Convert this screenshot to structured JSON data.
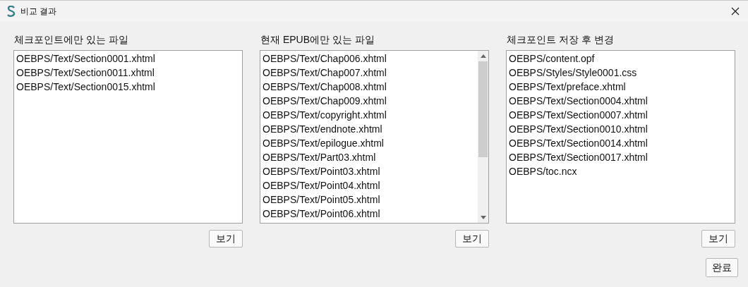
{
  "window": {
    "title": "비교 결과"
  },
  "panels": [
    {
      "label": "체크포인트에만 있는 파일",
      "items": [
        "OEBPS/Text/Section0001.xhtml",
        "OEBPS/Text/Section0011.xhtml",
        "OEBPS/Text/Section0015.xhtml"
      ],
      "scrollable": false,
      "button": "보기"
    },
    {
      "label": "현재 EPUB에만 있는 파일",
      "items": [
        "OEBPS/Text/Chap006.xhtml",
        "OEBPS/Text/Chap007.xhtml",
        "OEBPS/Text/Chap008.xhtml",
        "OEBPS/Text/Chap009.xhtml",
        "OEBPS/Text/copyright.xhtml",
        "OEBPS/Text/endnote.xhtml",
        "OEBPS/Text/epilogue.xhtml",
        "OEBPS/Text/Part03.xhtml",
        "OEBPS/Text/Point03.xhtml",
        "OEBPS/Text/Point04.xhtml",
        "OEBPS/Text/Point05.xhtml",
        "OEBPS/Text/Point06.xhtml"
      ],
      "scrollable": true,
      "button": "보기"
    },
    {
      "label": "체크포인트 저장 후 변경",
      "items": [
        "OEBPS/content.opf",
        "OEBPS/Styles/Style0001.css",
        "OEBPS/Text/preface.xhtml",
        "OEBPS/Text/Section0004.xhtml",
        "OEBPS/Text/Section0007.xhtml",
        "OEBPS/Text/Section0010.xhtml",
        "OEBPS/Text/Section0014.xhtml",
        "OEBPS/Text/Section0017.xhtml",
        "OEBPS/toc.ncx"
      ],
      "scrollable": false,
      "button": "보기"
    }
  ],
  "done_button": "완료"
}
